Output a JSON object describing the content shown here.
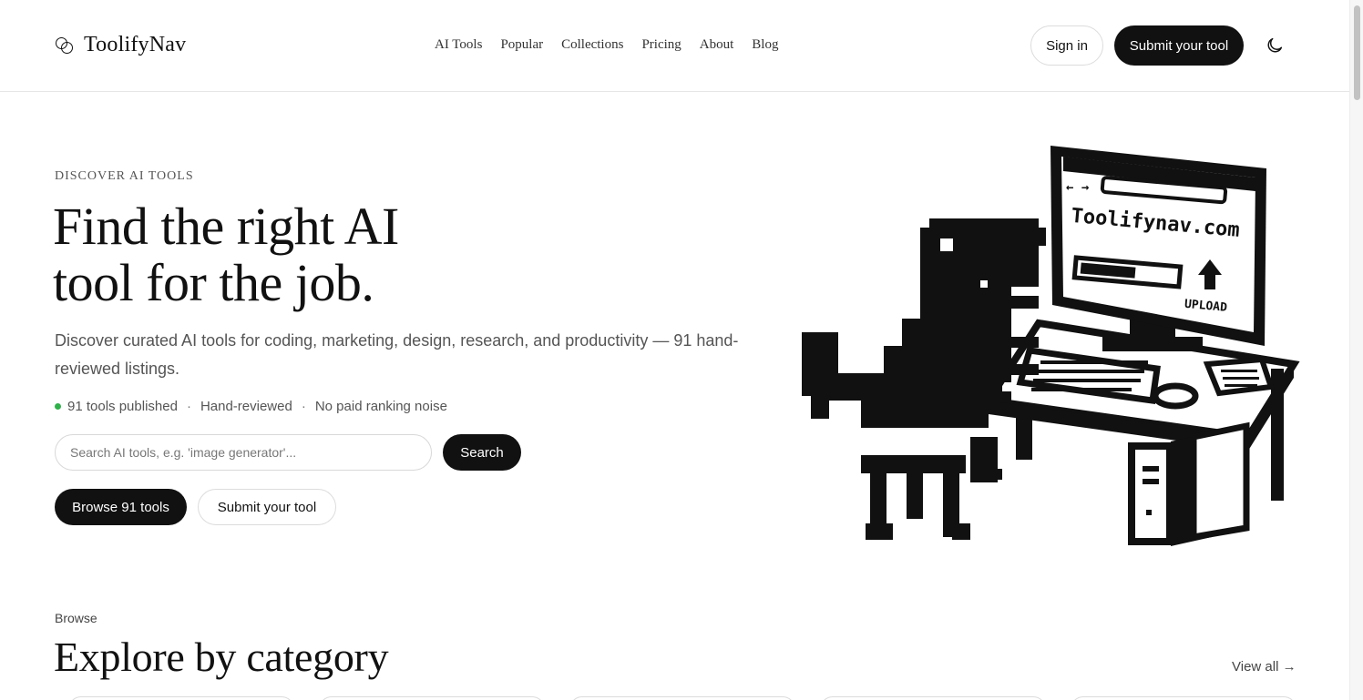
{
  "brand": {
    "name": "ToolifyNav"
  },
  "nav": {
    "items": [
      "AI Tools",
      "Popular",
      "Collections",
      "Pricing",
      "About",
      "Blog"
    ]
  },
  "header_actions": {
    "sign_in": "Sign in",
    "submit": "Submit your tool"
  },
  "hero": {
    "eyebrow": "DISCOVER AI TOOLS",
    "headline_line1": "Find the right AI",
    "headline_line2": "tool for the job.",
    "subtitle": "Discover curated AI tools for coding, marketing, design, research, and productivity — 91 hand-reviewed listings.",
    "stats": [
      "91 tools published",
      "Hand-reviewed",
      "No paid ranking noise"
    ],
    "search": {
      "placeholder": "Search AI tools, e.g. 'image generator'...",
      "value": "",
      "button": "Search"
    },
    "browse_button": "Browse 91 tools",
    "submit_button": "Submit your tool",
    "illustration": {
      "screen_text": "Toolifynav.com",
      "upload_label": "UPLOAD"
    }
  },
  "browse": {
    "label": "Browse",
    "title": "Explore by category",
    "view_all": "View all →"
  },
  "colors": {
    "accent": "#111111",
    "status_dot": "#2fb14a",
    "border": "#dcdcdc"
  },
  "icons": {
    "logo": "overlapping-circles-icon",
    "theme": "moon-icon"
  }
}
